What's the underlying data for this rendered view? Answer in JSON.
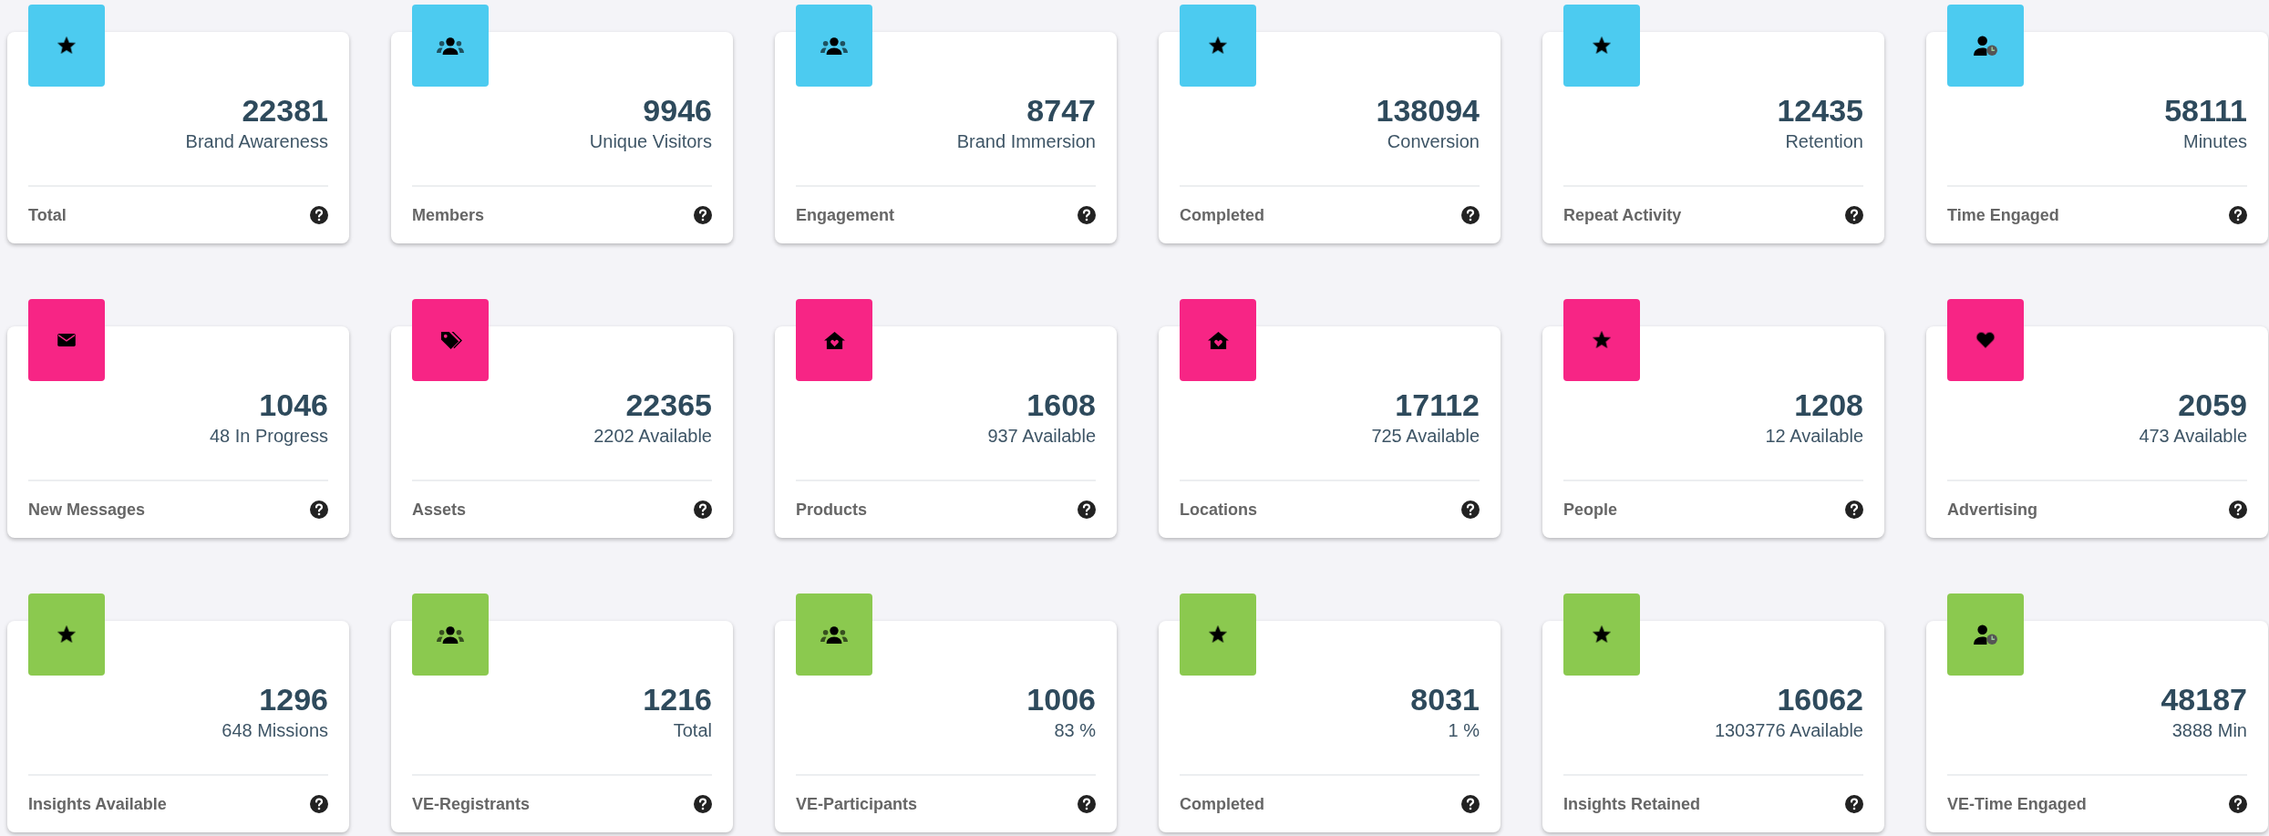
{
  "rows": [
    {
      "color": "#4ccbf0",
      "cards": [
        {
          "kind": "star",
          "value": "22381",
          "caption": "Brand Awareness",
          "label": "Total"
        },
        {
          "kind": "group",
          "value": "9946",
          "caption": "Unique Visitors",
          "label": "Members"
        },
        {
          "kind": "group",
          "value": "8747",
          "caption": "Brand Immersion",
          "label": "Engagement"
        },
        {
          "kind": "star",
          "value": "138094",
          "caption": "Conversion",
          "label": "Completed"
        },
        {
          "kind": "star",
          "value": "12435",
          "caption": "Retention",
          "label": "Repeat Activity"
        },
        {
          "kind": "user-clock",
          "value": "58111",
          "caption": "Minutes",
          "label": "Time Engaged"
        }
      ]
    },
    {
      "color": "#f72585",
      "cards": [
        {
          "kind": "envelope",
          "value": "1046",
          "caption": "48 In Progress",
          "label": "New Messages"
        },
        {
          "kind": "tags",
          "value": "22365",
          "caption": "2202 Available",
          "label": "Assets"
        },
        {
          "kind": "house",
          "value": "1608",
          "caption": "937 Available",
          "label": "Products"
        },
        {
          "kind": "house",
          "value": "17112",
          "caption": "725 Available",
          "label": "Locations"
        },
        {
          "kind": "star",
          "value": "1208",
          "caption": "12 Available",
          "label": "People"
        },
        {
          "kind": "heart",
          "value": "2059",
          "caption": "473 Available",
          "label": "Advertising"
        }
      ]
    },
    {
      "color": "#8bc94f",
      "cards": [
        {
          "kind": "star",
          "value": "1296",
          "caption": "648 Missions",
          "label": "Insights Available"
        },
        {
          "kind": "group",
          "value": "1216",
          "caption": "Total",
          "label": "VE-Registrants"
        },
        {
          "kind": "group",
          "value": "1006",
          "caption": "83 %",
          "label": "VE-Participants"
        },
        {
          "kind": "star",
          "value": "8031",
          "caption": "1 %",
          "label": "Completed"
        },
        {
          "kind": "star",
          "value": "16062",
          "caption": "1303776 Available",
          "label": "Insights Retained"
        },
        {
          "kind": "user-clock",
          "value": "48187",
          "caption": "3888 Min",
          "label": "VE-Time Engaged"
        }
      ]
    }
  ]
}
